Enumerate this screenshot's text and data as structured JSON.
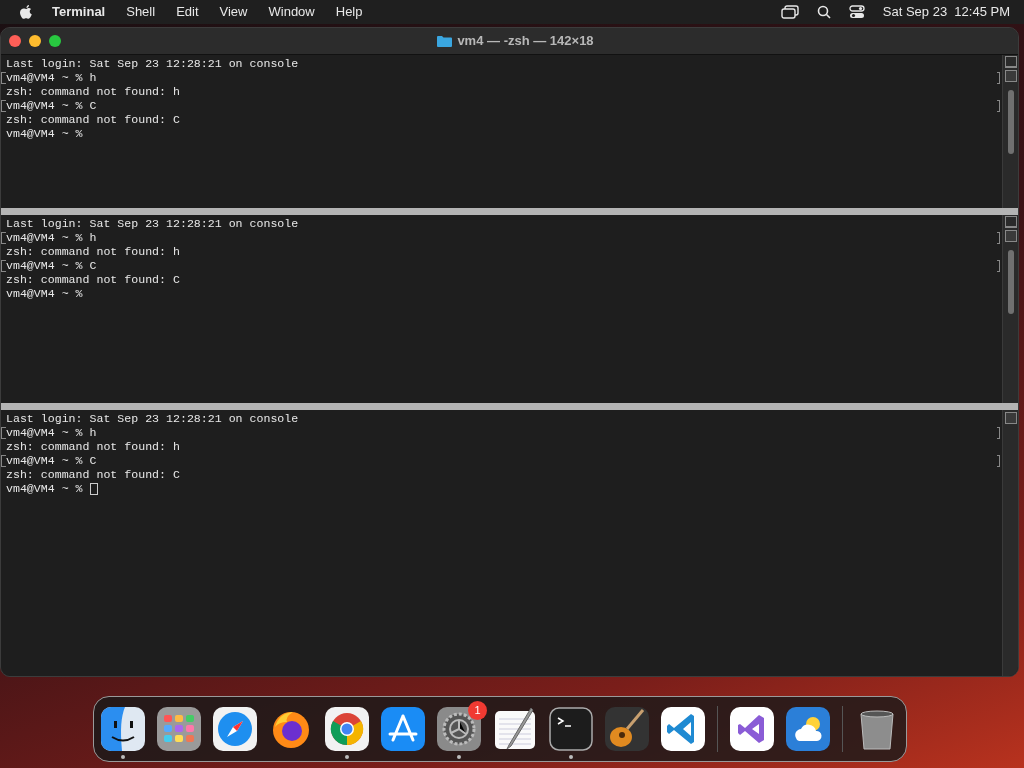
{
  "menu_bar": {
    "app": "Terminal",
    "items": [
      "Shell",
      "Edit",
      "View",
      "Window",
      "Help"
    ],
    "clock": "Sat Sep 23  12:45 PM"
  },
  "window": {
    "title": "vm4 — -zsh — 142×18",
    "panes": [
      {
        "scrollbar": true,
        "split_button": true,
        "lines": [
          {
            "text": "Last login: Sat Sep 23 12:28:21 on console",
            "marked": false
          },
          {
            "text": "vm4@VM4 ~ % h",
            "marked": true
          },
          {
            "text": "zsh: command not found: h",
            "marked": false
          },
          {
            "text": "vm4@VM4 ~ % C",
            "marked": true
          },
          {
            "text": "zsh: command not found: C",
            "marked": false
          },
          {
            "text": "vm4@VM4 ~ %",
            "marked": false
          }
        ]
      },
      {
        "scrollbar": true,
        "split_button": true,
        "lines": [
          {
            "text": "Last login: Sat Sep 23 12:28:21 on console",
            "marked": false
          },
          {
            "text": "vm4@VM4 ~ % h",
            "marked": true
          },
          {
            "text": "zsh: command not found: h",
            "marked": false
          },
          {
            "text": "vm4@VM4 ~ % C",
            "marked": true
          },
          {
            "text": "zsh: command not found: C",
            "marked": false
          },
          {
            "text": "vm4@VM4 ~ %",
            "marked": false
          }
        ]
      },
      {
        "cursor": true,
        "lines": [
          {
            "text": "Last login: Sat Sep 23 12:28:21 on console",
            "marked": false
          },
          {
            "text": "vm4@VM4 ~ % h",
            "marked": true
          },
          {
            "text": "zsh: command not found: h",
            "marked": false
          },
          {
            "text": "vm4@VM4 ~ % C",
            "marked": true
          },
          {
            "text": "zsh: command not found: C",
            "marked": false
          },
          {
            "text": "vm4@VM4 ~ %",
            "marked": false
          }
        ]
      }
    ]
  },
  "dock": {
    "apps": [
      {
        "kind": "finder",
        "running": true
      },
      {
        "kind": "launchpad",
        "running": false
      },
      {
        "kind": "safari",
        "running": false
      },
      {
        "kind": "firefox",
        "running": false
      },
      {
        "kind": "chrome",
        "running": true
      },
      {
        "kind": "appstore",
        "running": false
      },
      {
        "kind": "settings",
        "running": true,
        "badge": "1"
      },
      {
        "kind": "textedit",
        "running": false
      },
      {
        "kind": "terminal",
        "running": true
      },
      {
        "kind": "guitar",
        "running": false
      },
      {
        "kind": "vscode",
        "running": false
      },
      {
        "kind": "separator"
      },
      {
        "kind": "visualstudio",
        "running": false
      },
      {
        "kind": "weather",
        "running": false
      },
      {
        "kind": "separator"
      },
      {
        "kind": "trash",
        "running": false
      }
    ]
  }
}
